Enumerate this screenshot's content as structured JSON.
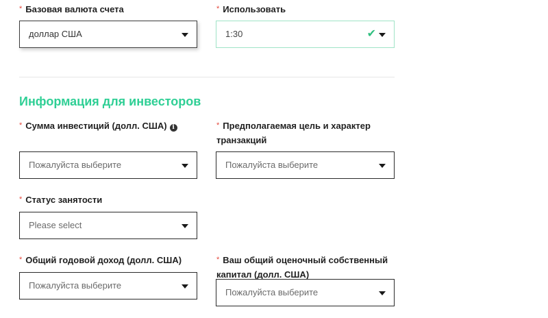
{
  "account": {
    "base_currency": {
      "label": "Базовая валюта счета",
      "value": "доллар США"
    },
    "leverage": {
      "label": "Использовать",
      "value": "1:30"
    }
  },
  "investor_info": {
    "title": "Информация для инвесторов",
    "investment_amount": {
      "label": "Сумма инвестиций (долл. США)",
      "value": "Пожалуйста выберите"
    },
    "transaction_purpose": {
      "label": "Предполагаемая цель и характер транзакций",
      "value": "Пожалуйста выберите"
    },
    "employment_status": {
      "label": "Статус занятости",
      "value": "Please select"
    },
    "annual_income": {
      "label": "Общий годовой доход (долл. США)",
      "value": "Пожалуйста выберите"
    },
    "net_worth": {
      "label": "Ваш общий оценочный собственный капитал (долл. США)",
      "value": "Пожалуйста выберите"
    }
  },
  "required_marker": "*",
  "info_icon_glyph": "i",
  "check_glyph": "✔",
  "colors": {
    "accent": "#2fcf95",
    "required": "#e4483c",
    "valid_border": "#9fe3c6",
    "check": "#2fbf7f"
  }
}
